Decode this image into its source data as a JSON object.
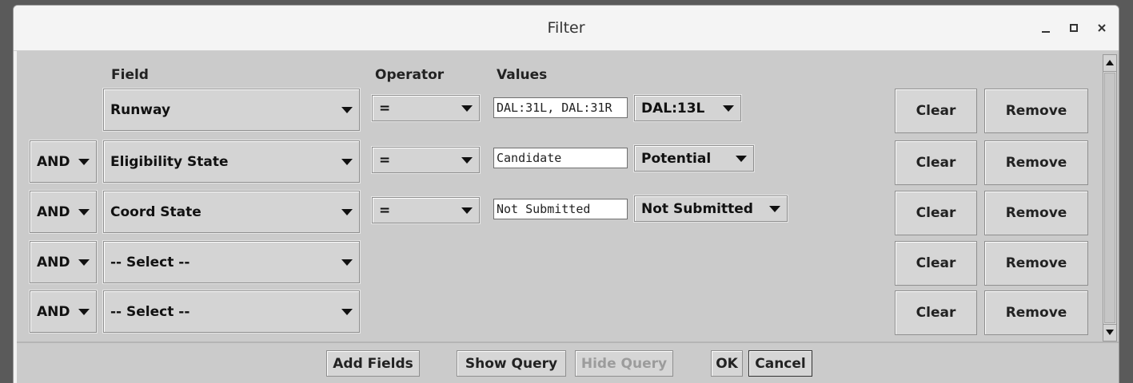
{
  "window": {
    "title": "Filter",
    "controls": {
      "minimize": "–",
      "maximize": "□",
      "close": "×"
    }
  },
  "headers": {
    "field": "Field",
    "operator": "Operator",
    "values": "Values"
  },
  "rows": [
    {
      "connector": "",
      "field": "Runway",
      "operator": "=",
      "value_text": "DAL:31L, DAL:31R",
      "value_select": "DAL:13L",
      "clear": "Clear",
      "remove": "Remove"
    },
    {
      "connector": "AND",
      "field": "Eligibility State",
      "operator": "=",
      "value_text": "Candidate",
      "value_select": "Potential",
      "clear": "Clear",
      "remove": "Remove"
    },
    {
      "connector": "AND",
      "field": "Coord State",
      "operator": "=",
      "value_text": "Not Submitted",
      "value_select": "Not Submitted",
      "clear": "Clear",
      "remove": "Remove"
    },
    {
      "connector": "AND",
      "field": "-- Select --",
      "operator": "",
      "value_text": "",
      "value_select": "",
      "clear": "Clear",
      "remove": "Remove"
    },
    {
      "connector": "AND",
      "field": "-- Select --",
      "operator": "",
      "value_text": "",
      "value_select": "",
      "clear": "Clear",
      "remove": "Remove"
    }
  ],
  "footer": {
    "add_fields": "Add Fields",
    "show_query": "Show Query",
    "hide_query": "Hide Query",
    "ok": "OK",
    "cancel": "Cancel"
  }
}
